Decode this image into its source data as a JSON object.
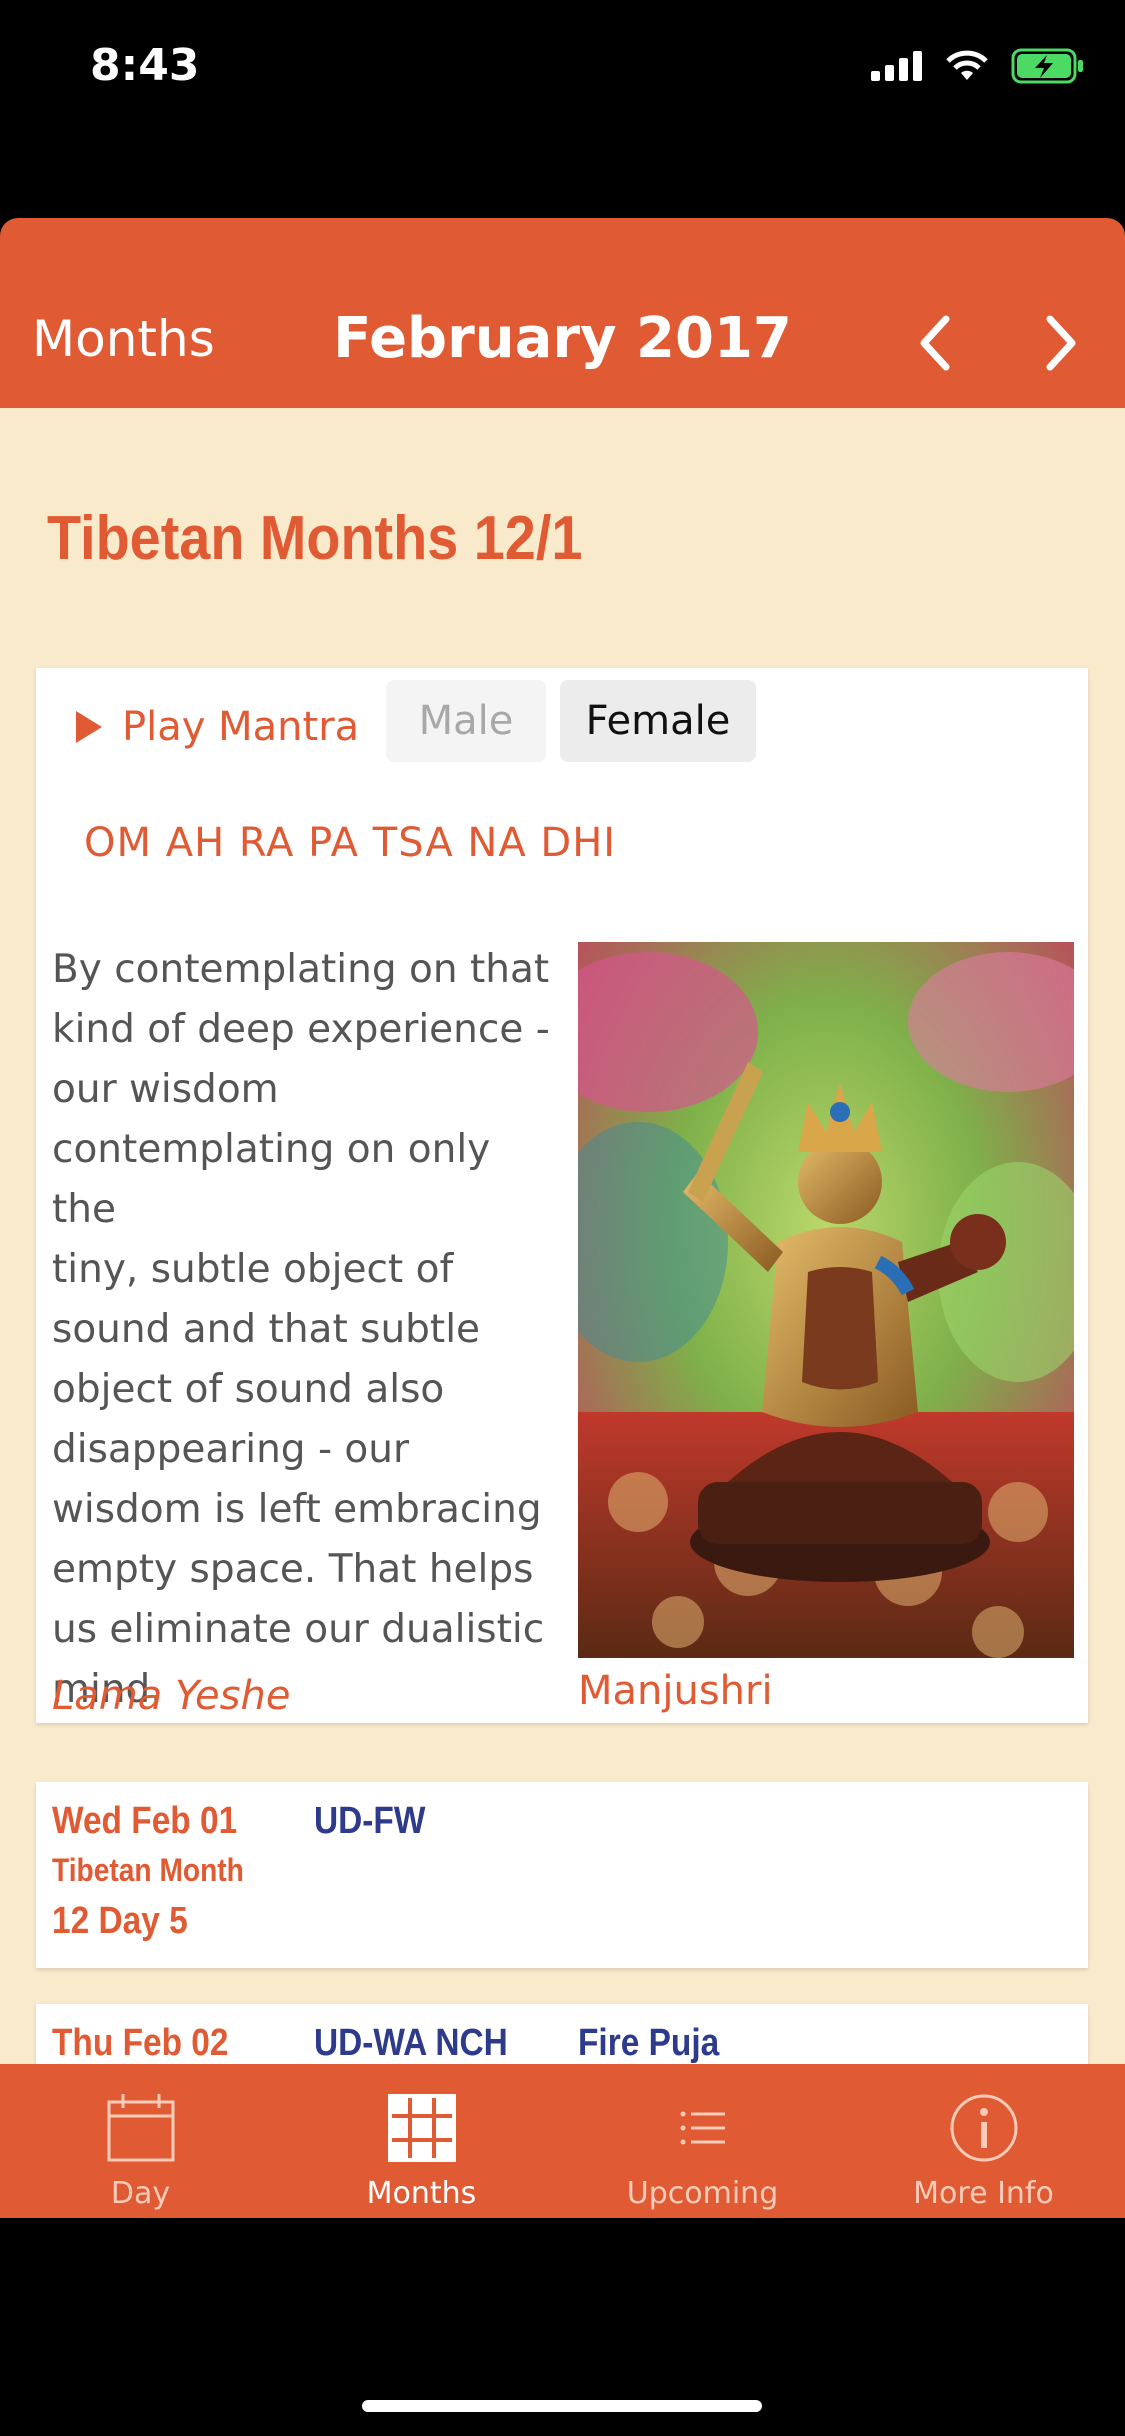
{
  "status_bar": {
    "time": "8:43"
  },
  "navbar": {
    "back_label": "Months",
    "title": "February 2017"
  },
  "page": {
    "title": "Tibetan Months 12/1"
  },
  "mantra_card": {
    "play_label": "Play Mantra",
    "voice_options": [
      "Male",
      "Female"
    ],
    "selected_voice": "Female",
    "mantra": "OM AH RA PA TSA NA DHI",
    "quote_lines": [
      "By contemplating on that",
      "kind of deep experience -",
      "our wisdom",
      "contemplating on only the",
      "tiny, subtle object of",
      "sound and that subtle",
      "object of sound also",
      "disappearing - our",
      "wisdom is left embracing",
      "empty space. That helps",
      "us eliminate our dualistic",
      "mind."
    ],
    "quote_author": "Lama Yeshe",
    "image_caption": "Manjushri"
  },
  "days": [
    {
      "date": "Wed Feb 01",
      "sub": "Tibetan Month",
      "sub2": "12 Day 5",
      "code": "UD-FW",
      "event": ""
    },
    {
      "date": "Thu Feb 02",
      "sub": "",
      "sub2": "",
      "code": "UD-WA NCH",
      "event": "Fire Puja"
    }
  ],
  "tabbar": {
    "tabs": [
      {
        "label": "Day",
        "icon": "calendar-icon"
      },
      {
        "label": "Months",
        "icon": "grid-icon"
      },
      {
        "label": "Upcoming",
        "icon": "list-icon"
      },
      {
        "label": "More Info",
        "icon": "info-icon"
      }
    ],
    "active": "Months"
  },
  "colors": {
    "accent": "#e05a33",
    "background": "#f8eacb",
    "blue_text": "#2e3a8c"
  }
}
